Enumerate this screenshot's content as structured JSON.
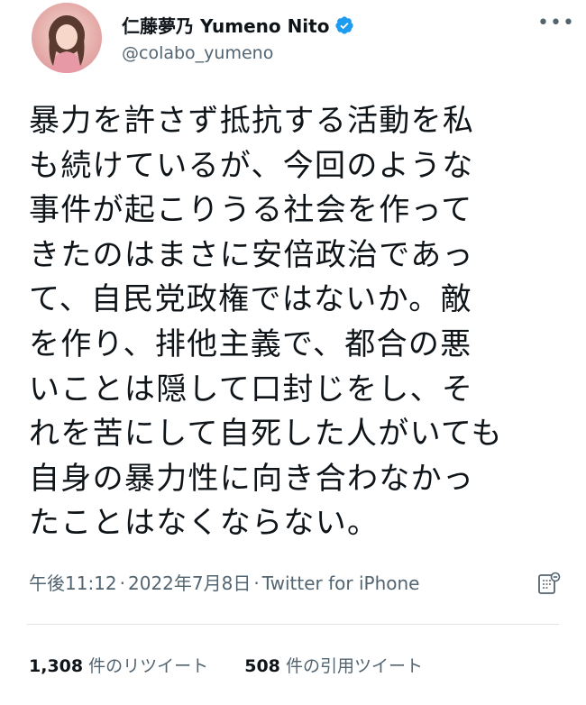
{
  "user": {
    "display_name": "仁藤夢乃 Yumeno Nito",
    "handle": "@colabo_yumeno"
  },
  "tweet": {
    "text": "暴力を許さず抵抗する活動を私\nも続けているが、今回のような\n事件が起こりうる社会を作って\nきたのはまさに安倍政治であっ\nて、自民党政権ではないか。敵\nを作り、排他主義で、都合の悪\nいことは隠して口封じをし、そ\nれを苦にして自死した人がいても\n自身の暴力性に向き合わなかっ\nたことはなくならない。",
    "time": "午後11:12",
    "date": "2022年7月8日",
    "source": "Twitter for iPhone"
  },
  "stats": {
    "retweets_count": "1,308",
    "retweets_label": "件のリツイート",
    "quotes_count": "508",
    "quotes_label": "件の引用ツイート"
  },
  "icons": {
    "verified": "verified-badge-icon",
    "more": "more-options-icon",
    "copy": "copy-text-icon"
  },
  "colors": {
    "verified_blue": "#1d9bf0",
    "secondary_text": "#536471"
  }
}
